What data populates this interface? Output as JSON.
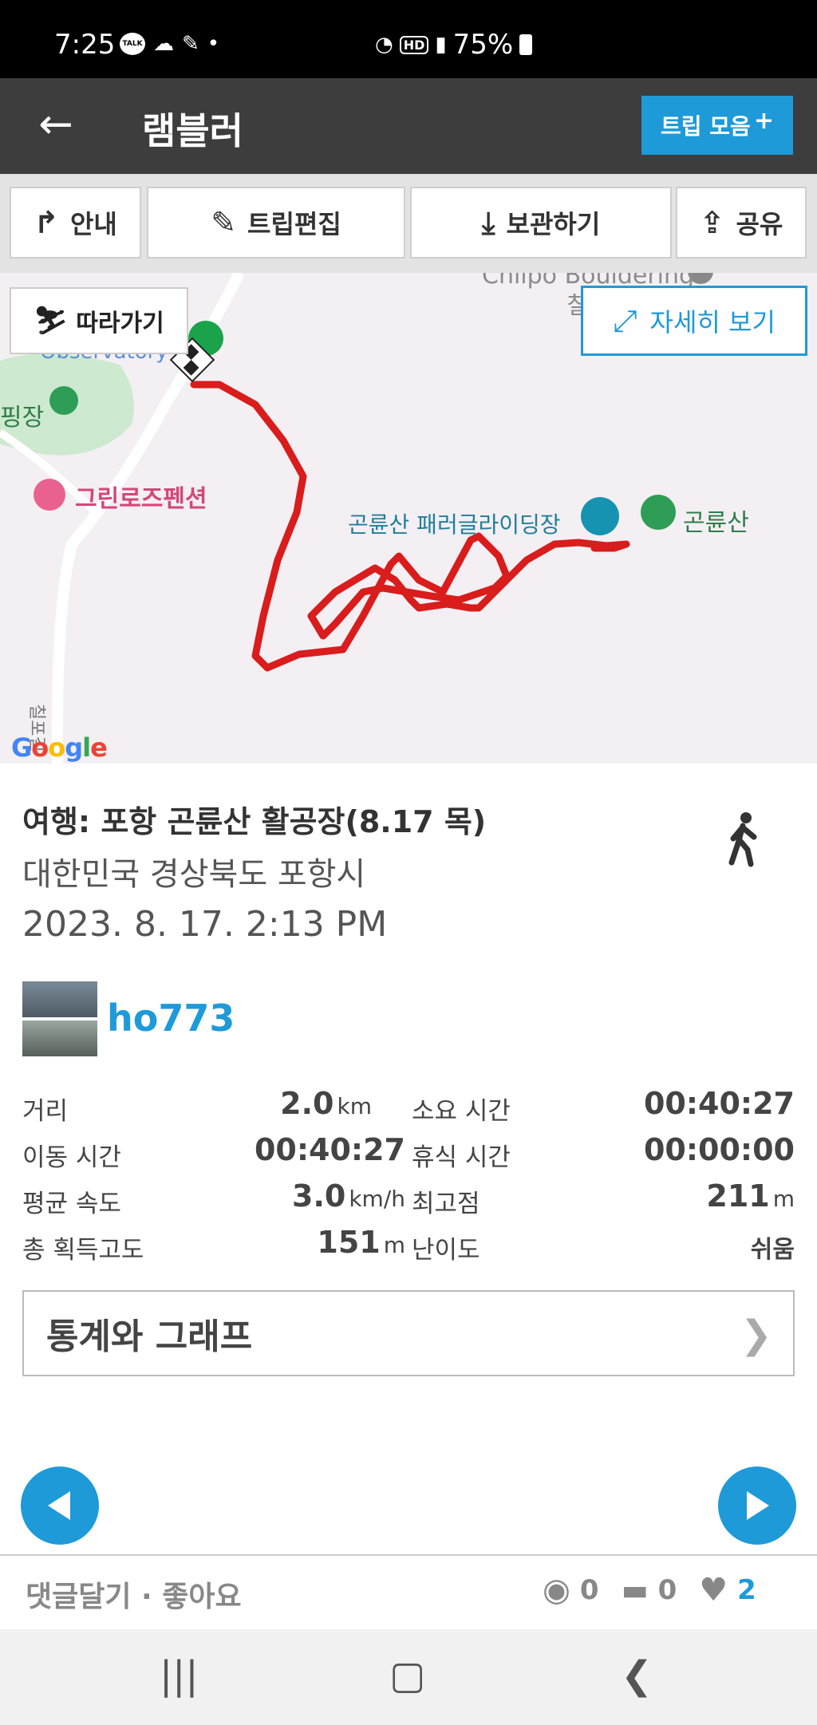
{
  "status_bar": {
    "time": "7:25",
    "talk": "TALK",
    "hd": "HD",
    "battery": "75%"
  },
  "app_bar": {
    "title": "램블러",
    "trip_collection": "트립 모음",
    "plus": "+"
  },
  "toolbar": {
    "guide": "안내",
    "edit": "트립편집",
    "save": "보관하기",
    "share": "공유"
  },
  "map": {
    "follow": "따라가기",
    "detail": "자세히 보기",
    "labels": {
      "bouldering": "Chilpo Bouldering",
      "bouldering2": "칠",
      "observatory": "Observatory",
      "camp": "핑장",
      "pension": "그린로즈펜션",
      "paragliding": "곤륜산 패러글라이딩장",
      "mountain": "곤륜산",
      "road": "칠포길"
    },
    "google": "Google"
  },
  "trip": {
    "title": "여행: 포항 곤륜산 활공장(8.17 목)",
    "location": "대한민국 경상북도 포항시",
    "date": "2023. 8. 17. 2:13 PM",
    "username": "ho773"
  },
  "stats": {
    "distance_label": "거리",
    "distance_value": "2.0",
    "distance_unit": "km",
    "duration_label": "소요 시간",
    "duration_value": "00:40:27",
    "moving_label": "이동 시간",
    "moving_value": "00:40:27",
    "rest_label": "휴식 시간",
    "rest_value": "00:00:00",
    "speed_label": "평균 속도",
    "speed_value": "3.0",
    "speed_unit": "km/h",
    "max_alt_label": "최고점",
    "max_alt_value": "211",
    "max_alt_unit": "m",
    "gain_label": "총 획득고도",
    "gain_value": "151",
    "gain_unit": "m",
    "difficulty_label": "난이도",
    "difficulty_value": "쉬움"
  },
  "graph_button": {
    "label": "통계와 그래프",
    "chevron": "❯"
  },
  "footer": {
    "links": "댓글달기 · 좋아요",
    "views": "0",
    "comments": "0",
    "likes": "2"
  },
  "colors": {
    "accent": "#1e9ad8",
    "route": "#d91c1c",
    "app_bar": "#3d3d3d"
  }
}
